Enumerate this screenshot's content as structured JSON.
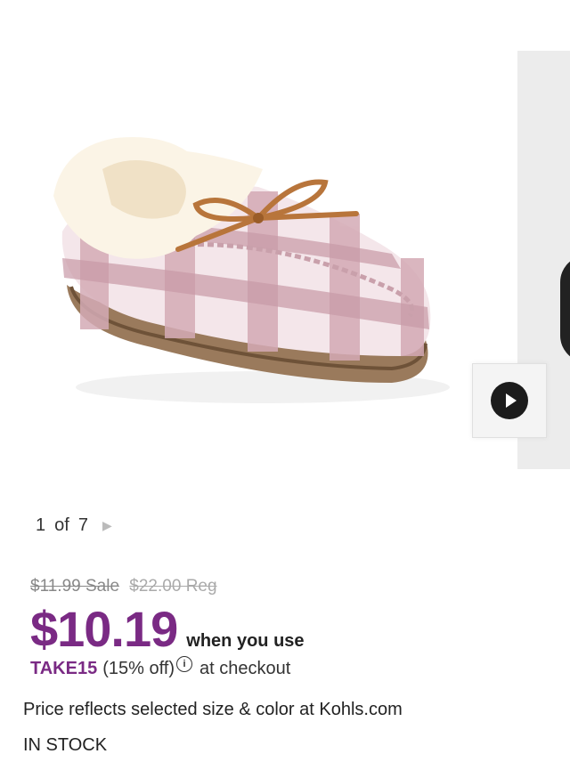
{
  "carousel": {
    "main_image_alt": "",
    "pager": {
      "current": "1",
      "of": "of",
      "total": "7"
    },
    "play_button_icon": "play-icon",
    "pager_arrow_icon": "caret-right-icon"
  },
  "pricing": {
    "sale_price": "$11.99 Sale",
    "regular_price": "$22.00 Reg",
    "promo_price": "$10.19",
    "promo_suffix": "when you use",
    "promo_code": "TAKE15",
    "promo_discount": "(15% off)",
    "promo_checkout": "at checkout",
    "note": "Price reflects selected size & color at Kohls.com",
    "accent_color": "#7a2a84"
  },
  "availability": {
    "status": "IN STOCK"
  }
}
